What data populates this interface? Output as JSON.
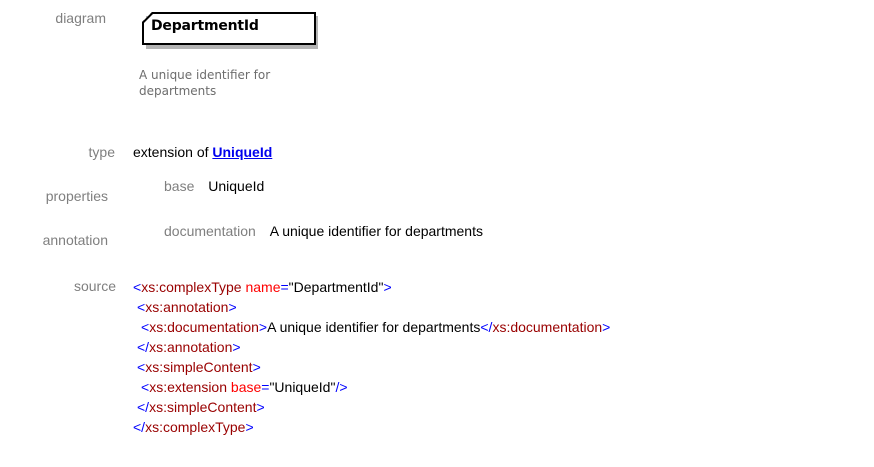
{
  "labels": {
    "diagram": "diagram",
    "type": "type",
    "properties": "properties",
    "annotation": "annotation",
    "source": "source"
  },
  "diagram": {
    "name": "DepartmentId",
    "doc_line1": "A unique identifier for",
    "doc_line2": "departments"
  },
  "type": {
    "prefix": "extension of",
    "link": "UniqueId"
  },
  "properties": {
    "key": "base",
    "value": "UniqueId"
  },
  "annotation": {
    "key": "documentation",
    "value": "A unique identifier for departments"
  },
  "source": {
    "l1": {
      "tag": "xs:complexType",
      "attr": "name",
      "val": "\"DepartmentId\""
    },
    "l2": {
      "tag": "xs:annotation"
    },
    "l3": {
      "tag": "xs:documentation",
      "text": "A unique identifier for departments",
      "close_tag": "xs:documentation"
    },
    "l4": {
      "tag": "xs:annotation"
    },
    "l5": {
      "tag": "xs:simpleContent"
    },
    "l6": {
      "tag": "xs:extension",
      "attr": "base",
      "val": "\"UniqueId\""
    },
    "l7": {
      "tag": "xs:simpleContent"
    },
    "l8": {
      "tag": "xs:complexType"
    }
  },
  "colors": {
    "label_gray": "#7f7f7f",
    "link_blue": "#0000ee",
    "xml_bracket": "#0000ff",
    "xml_element": "#990000",
    "xml_attribute": "#ff0000"
  }
}
